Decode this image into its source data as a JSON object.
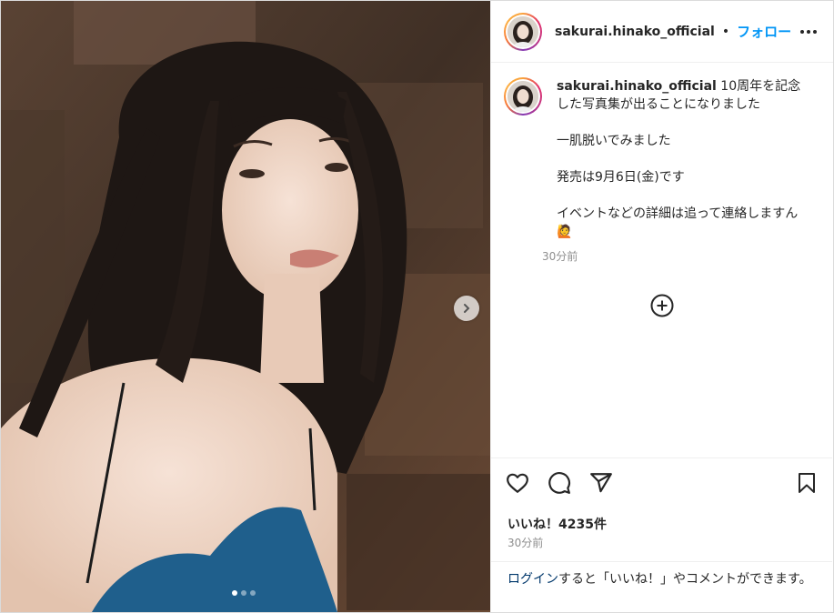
{
  "header": {
    "username": "sakurai.hinako_official",
    "separator": "•",
    "follow_label": "フォロー"
  },
  "caption": {
    "username": "sakurai.hinako_official",
    "text": " 10周年を記念した写真集が出ることになりました\n\n一肌脱いでみました\n\n発売は9月6日(金)です\n\nイベントなどの詳細は追って連絡しますん🙋",
    "time": "30分前"
  },
  "actions": {
    "icons": [
      "heart-icon",
      "comment-icon",
      "share-icon",
      "bookmark-icon"
    ]
  },
  "likes": "いいね！4235件",
  "post_time": "30分前",
  "login_prompt": {
    "link": "ログイン",
    "rest": "すると「いいね！」やコメントができます。"
  },
  "carousel": {
    "slide_count": 3,
    "active_index": 0
  },
  "colors": {
    "follow": "#0095f6",
    "login_link": "#00376b",
    "muted": "#8e8e8e",
    "dress": "#1f5f8c"
  }
}
